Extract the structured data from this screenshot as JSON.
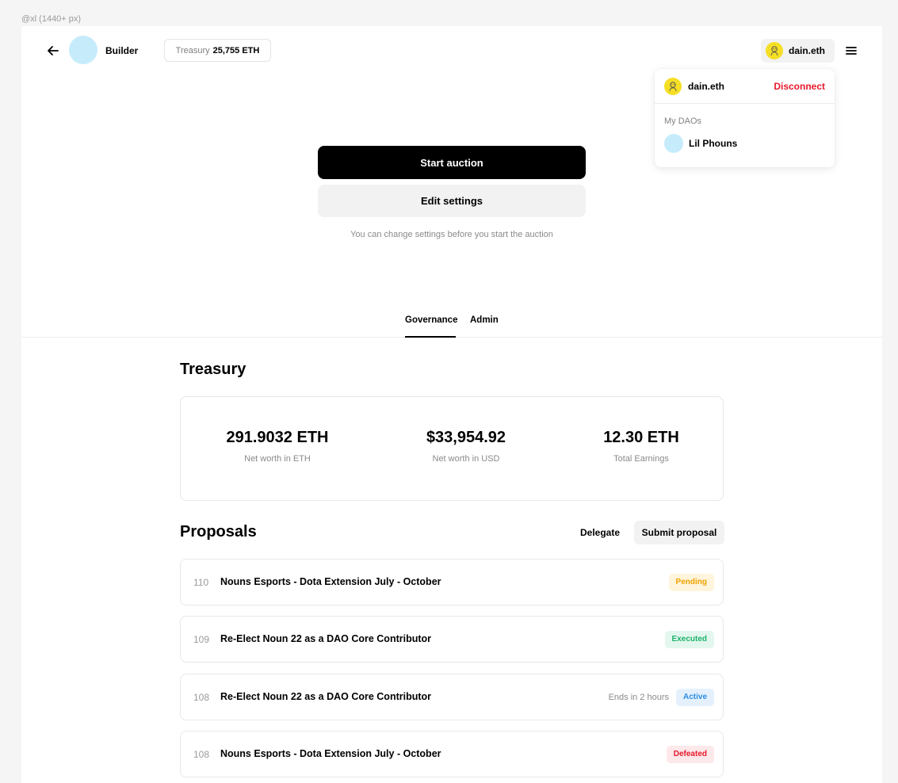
{
  "frame_label": "@xl (1440+ px)",
  "header": {
    "dao_name": "Builder",
    "treasury_label": "Treasury",
    "treasury_value": "25,755 ETH",
    "wallet_name": "dain.eth"
  },
  "dropdown": {
    "user": "dain.eth",
    "disconnect": "Disconnect",
    "section": "My DAOs",
    "daos": [
      {
        "name": "Lil Phouns"
      }
    ]
  },
  "auction": {
    "start_label": "Start auction",
    "edit_label": "Edit settings",
    "hint": "You can change settings before you start the auction"
  },
  "tabs": {
    "governance": "Governance",
    "admin": "Admin"
  },
  "treasury": {
    "heading": "Treasury",
    "stats": [
      {
        "value": "291.9032 ETH",
        "label": "Net worth in ETH"
      },
      {
        "value": "$33,954.92",
        "label": "Net worth in USD"
      },
      {
        "value": "12.30 ETH",
        "label": "Total Earnings"
      }
    ]
  },
  "proposals": {
    "heading": "Proposals",
    "delegate_label": "Delegate",
    "submit_label": "Submit proposal",
    "items": [
      {
        "number": "110",
        "title": "Nouns Esports - Dota Extension July - October",
        "status": "Pending",
        "ends": ""
      },
      {
        "number": "109",
        "title": "Re-Elect Noun 22 as a DAO Core Contributor",
        "status": "Executed",
        "ends": ""
      },
      {
        "number": "108",
        "title": "Re-Elect Noun 22 as a DAO Core Contributor",
        "status": "Active",
        "ends": "Ends in 2 hours"
      },
      {
        "number": "108",
        "title": "Nouns Esports - Dota Extension July - October",
        "status": "Defeated",
        "ends": ""
      }
    ]
  },
  "colors": {
    "accent_black": "#000000",
    "disconnect_red": "#e8192c",
    "pending": "#f0a100",
    "executed": "#1fb26b",
    "active": "#2b8de0",
    "defeated": "#e8192c",
    "dao_avatar": "#c6ecfb",
    "ens_avatar": "#f5df25"
  }
}
